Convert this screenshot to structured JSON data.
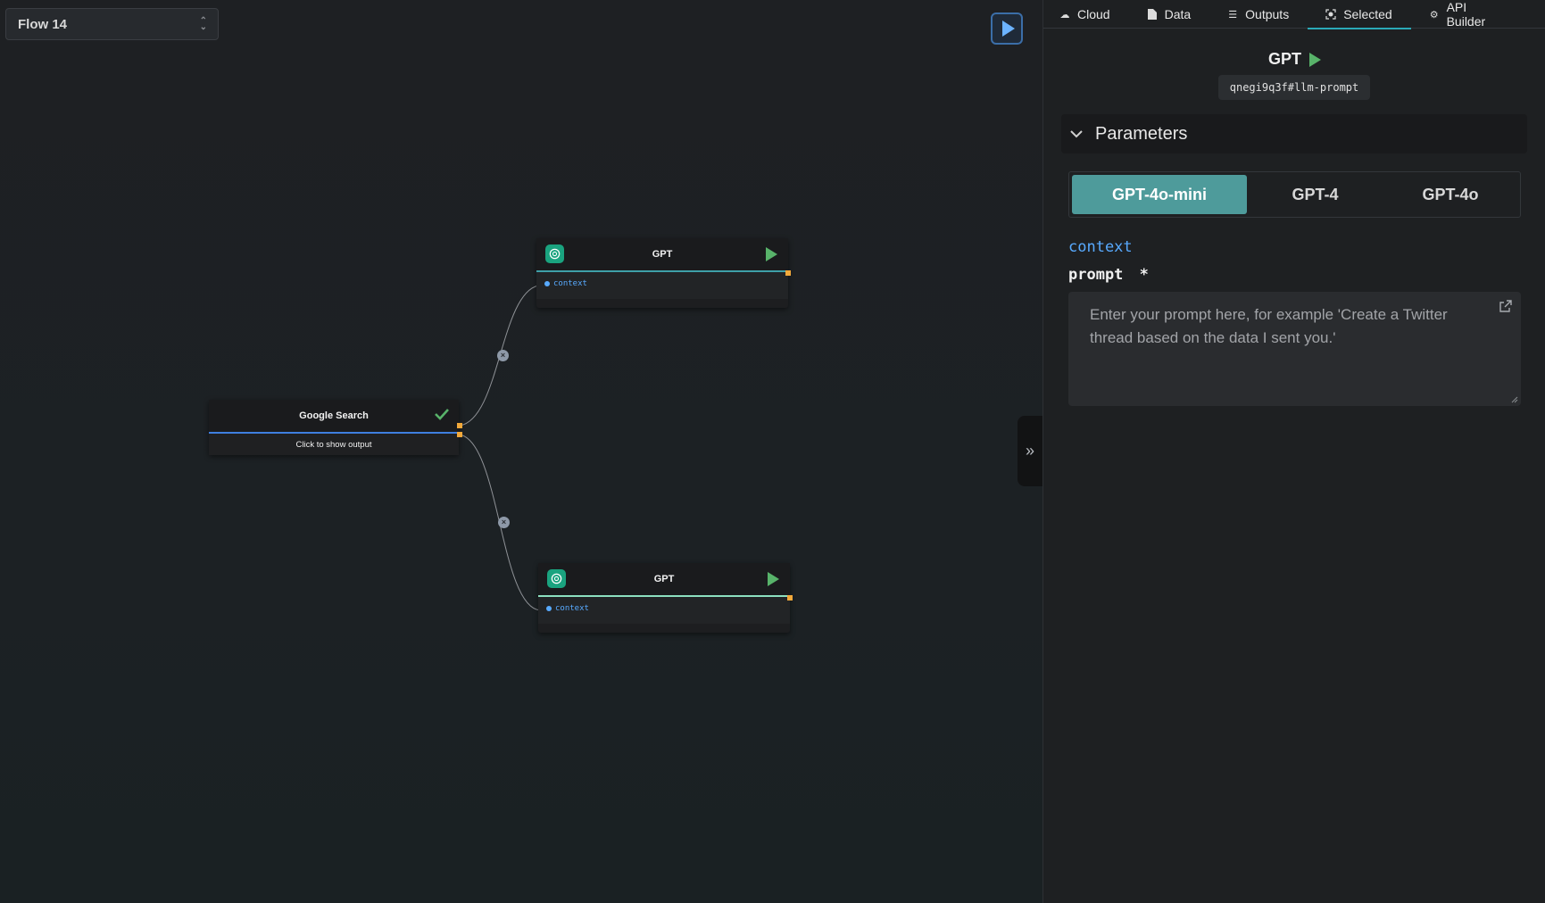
{
  "flow_select": {
    "value": "Flow 14"
  },
  "nodes": {
    "google_search": {
      "title": "Google Search",
      "output_link": "Click to show output"
    },
    "gpt_top": {
      "title": "GPT",
      "input_label": "context"
    },
    "gpt_bottom": {
      "title": "GPT",
      "input_label": "context"
    }
  },
  "panel": {
    "tabs": [
      {
        "label": "Cloud",
        "icon": "cloud-icon"
      },
      {
        "label": "Data",
        "icon": "file-icon"
      },
      {
        "label": "Outputs",
        "icon": "list-icon"
      },
      {
        "label": "Selected",
        "icon": "target-icon"
      },
      {
        "label": "API Builder",
        "icon": "gears-icon"
      }
    ],
    "active_tab": "Selected",
    "node_title": "GPT",
    "node_id": "qnegi9q3f#llm-prompt",
    "section_title": "Parameters",
    "models": [
      "GPT-4o-mini",
      "GPT-4",
      "GPT-4o"
    ],
    "selected_model": "GPT-4o-mini",
    "context_label": "context",
    "prompt_label": "prompt",
    "required_mark": "*",
    "prompt_value": "",
    "prompt_placeholder": "Enter your prompt here, for example 'Create a Twitter thread based on the data I sent you.'"
  },
  "colors": {
    "accent_teal": "#4e9b9b",
    "context_blue": "#58aaff",
    "play_green": "#58b36a",
    "handle_orange": "#f2a93b"
  }
}
